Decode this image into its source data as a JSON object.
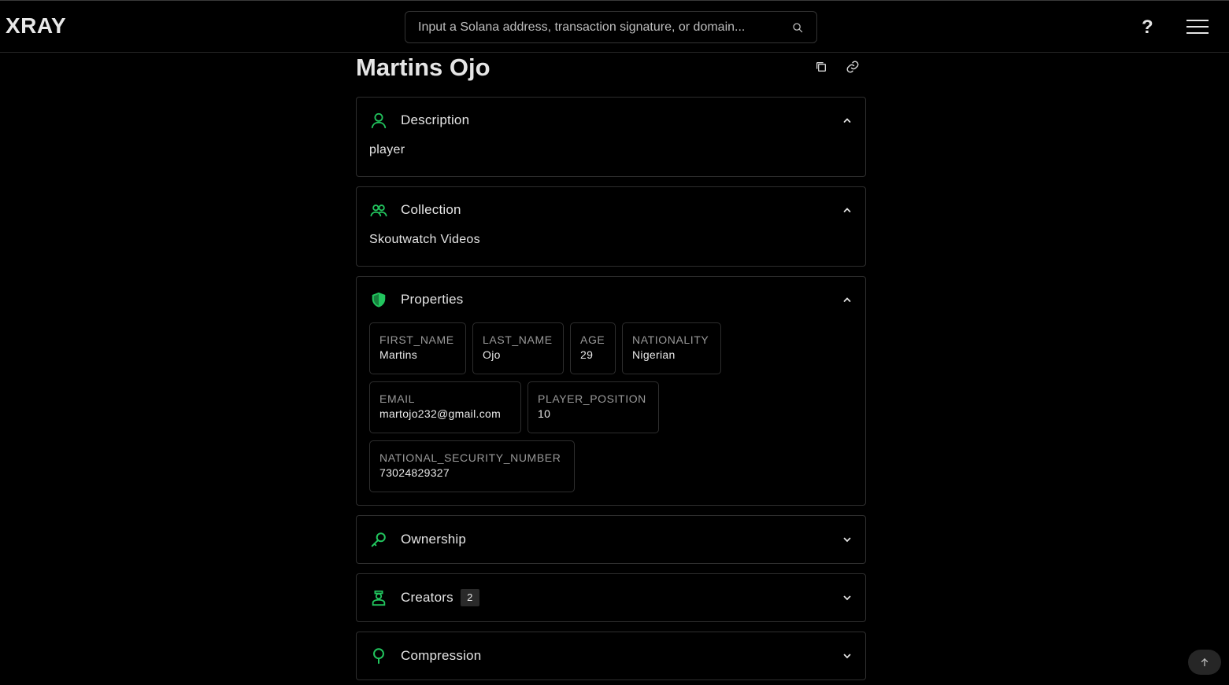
{
  "app": {
    "logo": "XRAY"
  },
  "search": {
    "placeholder": "Input a Solana address, transaction signature, or domain..."
  },
  "header": {
    "help_label": "?"
  },
  "asset": {
    "title": "Martins Ojo"
  },
  "sections": {
    "description": {
      "title": "Description",
      "value": "player",
      "expanded": true,
      "icon": "user-icon"
    },
    "collection": {
      "title": "Collection",
      "value": "Skoutwatch Videos",
      "expanded": true,
      "icon": "users-icon"
    },
    "properties": {
      "title": "Properties",
      "expanded": true,
      "icon": "shield-icon",
      "items": [
        {
          "key": "FIRST_NAME",
          "value": "Martins"
        },
        {
          "key": "LAST_NAME",
          "value": "Ojo"
        },
        {
          "key": "AGE",
          "value": "29"
        },
        {
          "key": "NATIONALITY",
          "value": "Nigerian"
        },
        {
          "key": "EMAIL",
          "value": "martojo232@gmail.com"
        },
        {
          "key": "PLAYER_POSITION",
          "value": "10"
        },
        {
          "key": "NATIONAL_SECURITY_NUMBER",
          "value": "73024829327"
        }
      ]
    },
    "ownership": {
      "title": "Ownership",
      "expanded": false,
      "icon": "key-icon"
    },
    "creators": {
      "title": "Creators",
      "count": "2",
      "expanded": false,
      "icon": "creator-icon"
    },
    "compression": {
      "title": "Compression",
      "expanded": false,
      "icon": "tree-icon"
    }
  },
  "colors": {
    "accent": "#22c55e",
    "background": "#000000",
    "border": "#2e2e2e",
    "muted_text": "#9a9a9a"
  }
}
